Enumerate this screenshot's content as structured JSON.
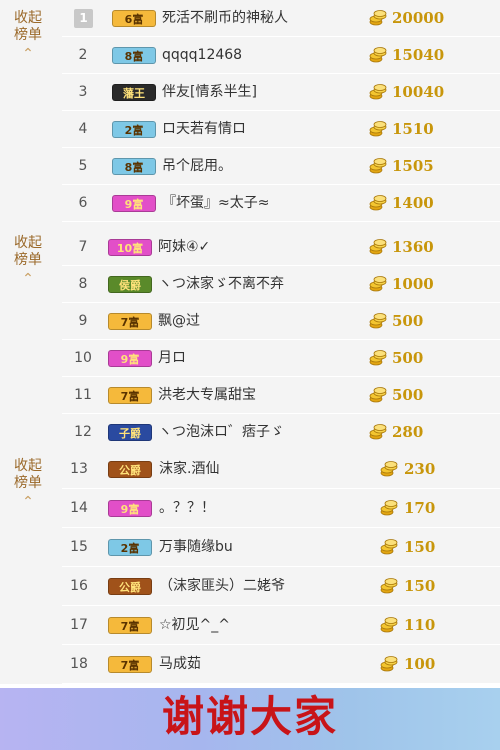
{
  "sections": [
    {
      "collapse_label": [
        "收起",
        "榜单"
      ],
      "rows": [
        {
          "rank": "1",
          "badge": "6富",
          "name": "死活不刷币的神秘人",
          "amount": "20000"
        },
        {
          "rank": "2",
          "badge": "8富",
          "name": "qqqq12468",
          "amount": "15040"
        },
        {
          "rank": "3",
          "badge": "藩王",
          "name": "伴友[情系半生]",
          "amount": "10040"
        },
        {
          "rank": "4",
          "badge": "2富",
          "name": "ロ天若有情ロ",
          "amount": "1510"
        },
        {
          "rank": "5",
          "badge": "8富",
          "name": "吊个屁用。",
          "amount": "1505"
        },
        {
          "rank": "6",
          "badge": "9富",
          "name": "『坏蛋』≈太子≈",
          "amount": "1400"
        }
      ]
    },
    {
      "collapse_label": [
        "收起",
        "榜单"
      ],
      "rows": [
        {
          "rank": "7",
          "badge": "10富",
          "name": "阿妹④✓",
          "amount": "1360"
        },
        {
          "rank": "8",
          "badge": "侯爵",
          "name": "ヽつ沫家ゞ不离不弃",
          "amount": "1000"
        },
        {
          "rank": "9",
          "badge": "7富",
          "name": "飘@过",
          "amount": "500"
        },
        {
          "rank": "10",
          "badge": "9富",
          "name": "月ロ",
          "amount": "500"
        },
        {
          "rank": "11",
          "badge": "7富",
          "name": "洪老大专属甜宝",
          "amount": "500"
        },
        {
          "rank": "12",
          "badge": "子爵",
          "name": "ヽつ泡沫ロ゛痞子ゞ",
          "amount": "280"
        }
      ]
    },
    {
      "collapse_label": [
        "收起",
        "榜单"
      ],
      "rows": [
        {
          "rank": "13",
          "badge": "公爵",
          "name": "沫家.酒仙",
          "amount": "230"
        },
        {
          "rank": "14",
          "badge": "9富",
          "name": "。？？！",
          "amount": "170"
        },
        {
          "rank": "15",
          "badge": "2富",
          "name": "万事随缘bu",
          "amount": "150"
        },
        {
          "rank": "16",
          "badge": "公爵",
          "name": "（沫家匪头）二姥爷",
          "amount": "150"
        },
        {
          "rank": "17",
          "badge": "7富",
          "name": "☆初见^_^",
          "amount": "110"
        },
        {
          "rank": "18",
          "badge": "7富",
          "name": "马成茹",
          "amount": "100"
        }
      ]
    }
  ],
  "badge_colors": {
    "2富": "#7ec8e6",
    "6富": "#f5b93b",
    "7富": "#f5b93b",
    "8富": "#7ec8e6",
    "9富": "#e24fc8",
    "10富": "#e24fc8",
    "藩王": "#2a2a2a",
    "侯爵": "#5a8a2a",
    "子爵": "#2a4aa0",
    "公爵": "#a0521a"
  },
  "coin_icon": "gold-coin-icon",
  "caret_icon": "chevron-up-icon",
  "amount_color": "#c8960b",
  "footer": {
    "text": "谢谢大家"
  }
}
